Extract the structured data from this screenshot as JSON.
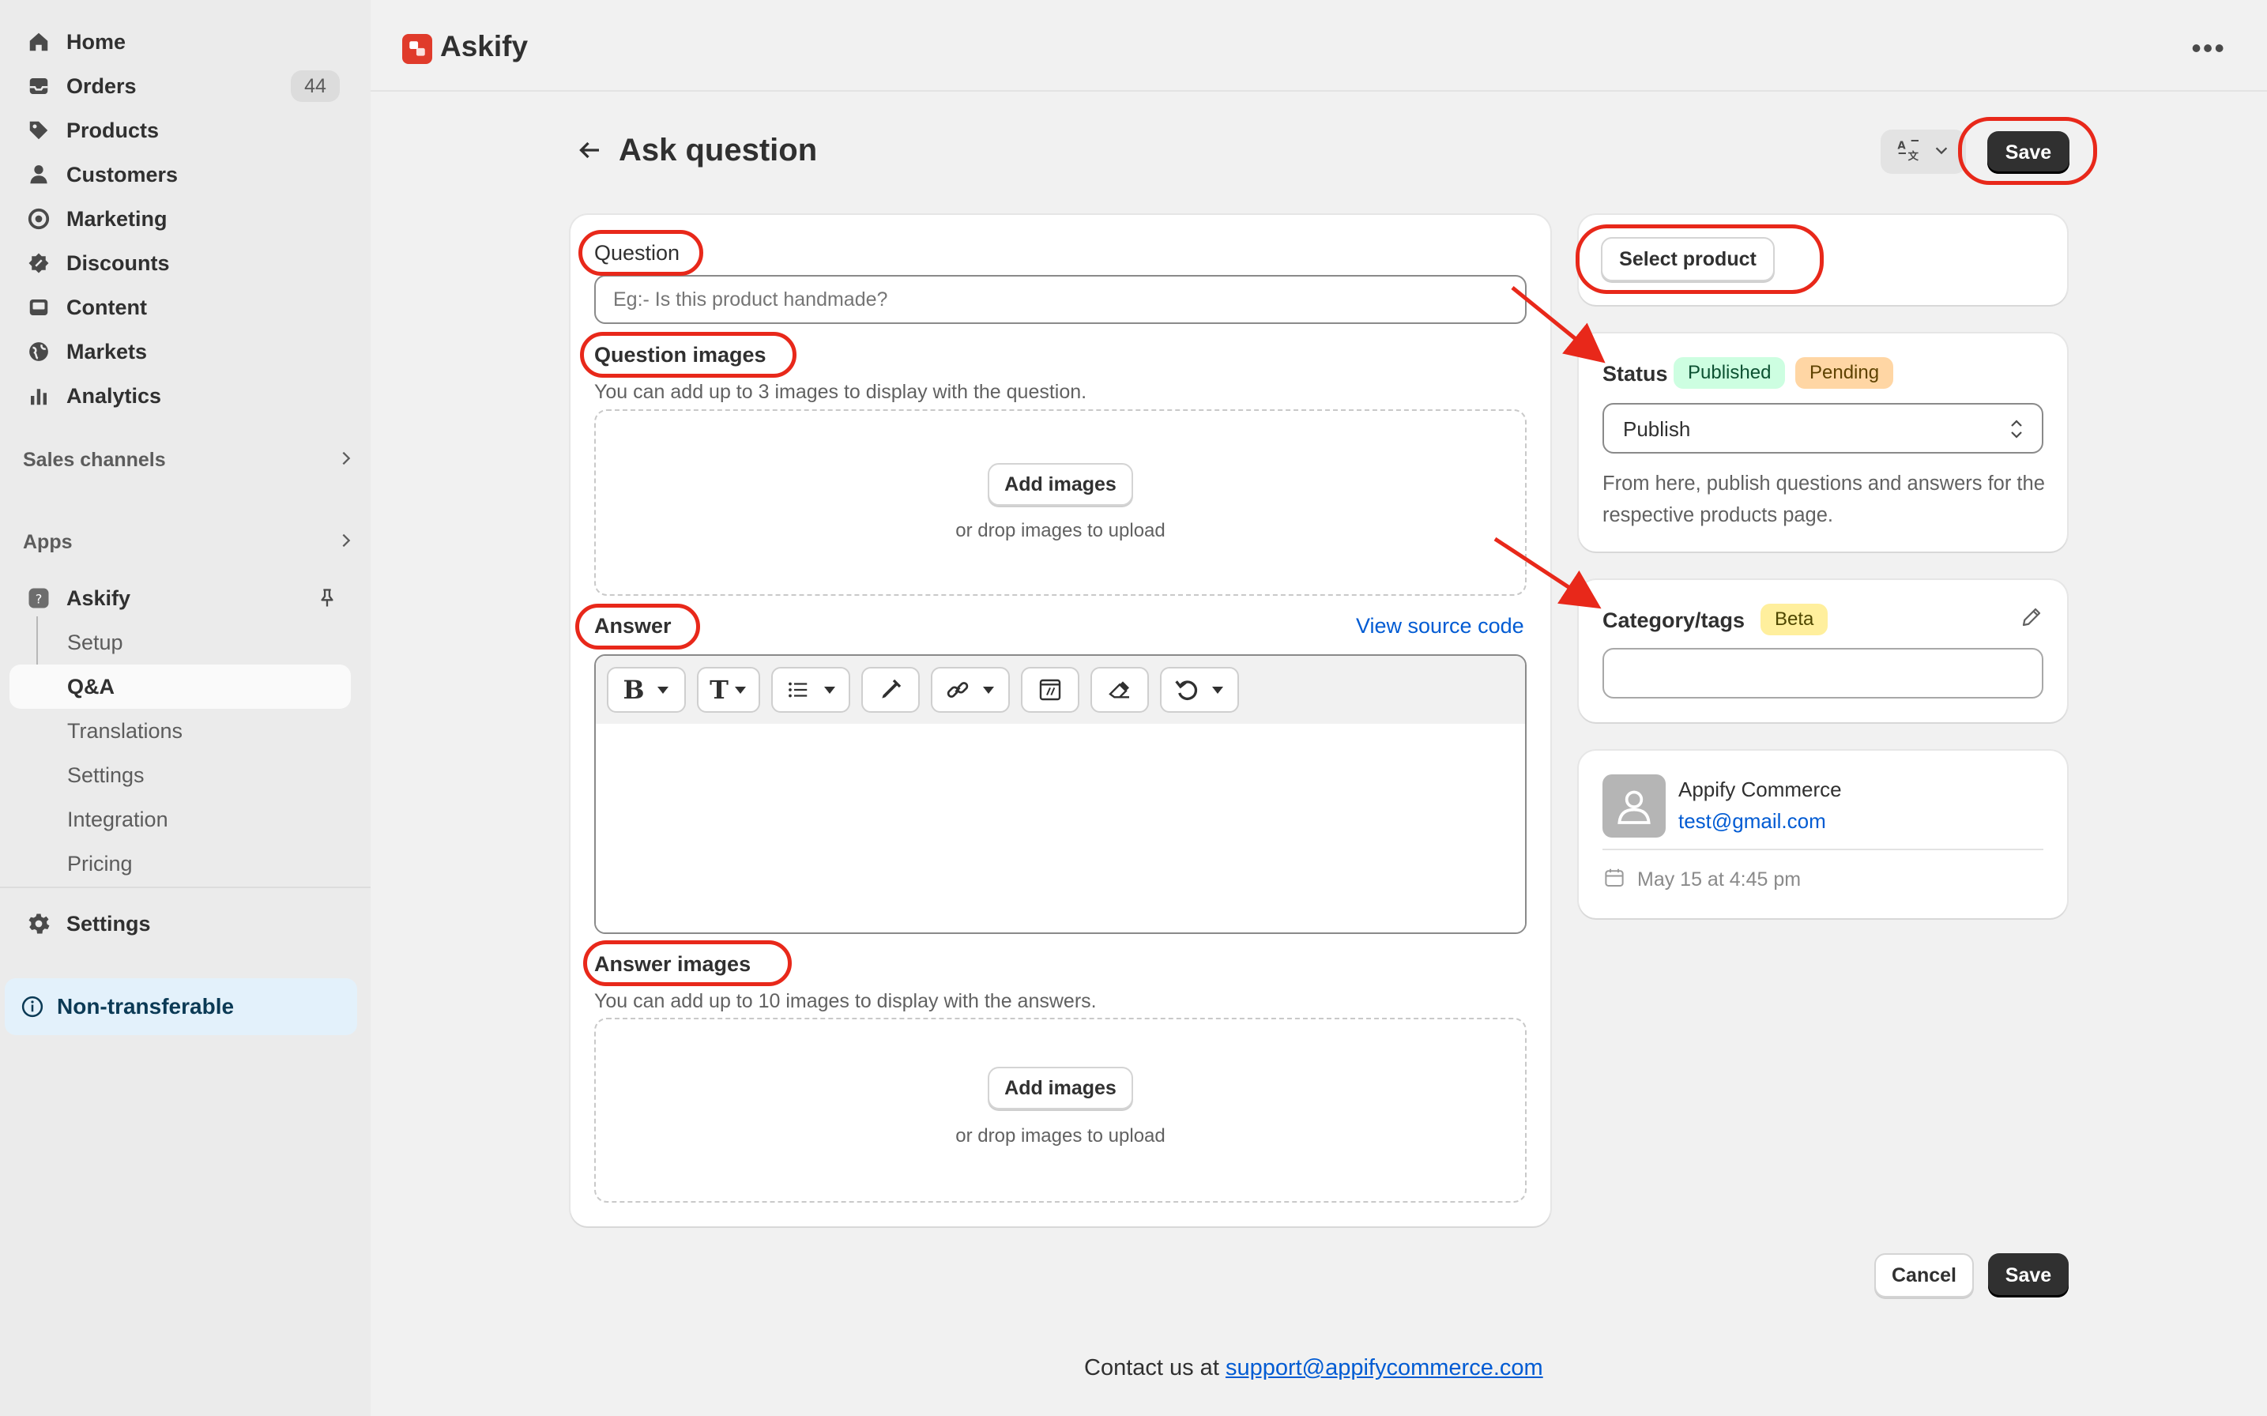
{
  "sidebar": {
    "items": [
      {
        "label": "Home",
        "icon": "home-icon"
      },
      {
        "label": "Orders",
        "icon": "orders-icon",
        "badge": "44"
      },
      {
        "label": "Products",
        "icon": "tag-icon"
      },
      {
        "label": "Customers",
        "icon": "person-icon"
      },
      {
        "label": "Marketing",
        "icon": "target-icon"
      },
      {
        "label": "Discounts",
        "icon": "discount-icon"
      },
      {
        "label": "Content",
        "icon": "image-icon"
      },
      {
        "label": "Markets",
        "icon": "globe-icon"
      },
      {
        "label": "Analytics",
        "icon": "bar-chart-icon"
      }
    ],
    "sales_channels": "Sales channels",
    "apps": "Apps",
    "app_name": "Askify",
    "app_subitems": [
      "Setup",
      "Q&A",
      "Translations",
      "Settings",
      "Integration",
      "Pricing"
    ],
    "settings": "Settings",
    "non_transferable": "Non-transferable"
  },
  "topbar": {
    "app_title": "Askify"
  },
  "page": {
    "title": "Ask question",
    "save": "Save",
    "cancel": "Cancel"
  },
  "form": {
    "question_label": "Question",
    "question_placeholder": "Eg:- Is this product handmade?",
    "question_images_label": "Question images",
    "question_images_hint": "You can add up to 3 images to display with the question.",
    "add_images": "Add images",
    "drop_hint": "or drop images to upload",
    "answer_label": "Answer",
    "view_source": "View source code",
    "answer_images_label": "Answer images",
    "answer_images_hint": "You can add up to 10 images to display with the answers."
  },
  "side": {
    "select_product": "Select product",
    "status_label": "Status",
    "published_badge": "Published",
    "pending_badge": "Pending",
    "status_value": "Publish",
    "status_help": "From here, publish questions and answers for the respective products page.",
    "category_label": "Category/tags",
    "beta_badge": "Beta",
    "customer_name": "Appify Commerce",
    "customer_email": "test@gmail.com",
    "date": "May 15 at 4:45 pm"
  },
  "footer": {
    "contact_prefix": "Contact us at",
    "contact_email": "support@appifycommerce.com"
  },
  "colors": {
    "accent_red": "#e8281a",
    "primary_dark": "#303030",
    "link": "#005bd3",
    "published_bg": "#cdfee1",
    "pending_bg": "#ffd6a4",
    "beta_bg": "#ffef9d"
  }
}
